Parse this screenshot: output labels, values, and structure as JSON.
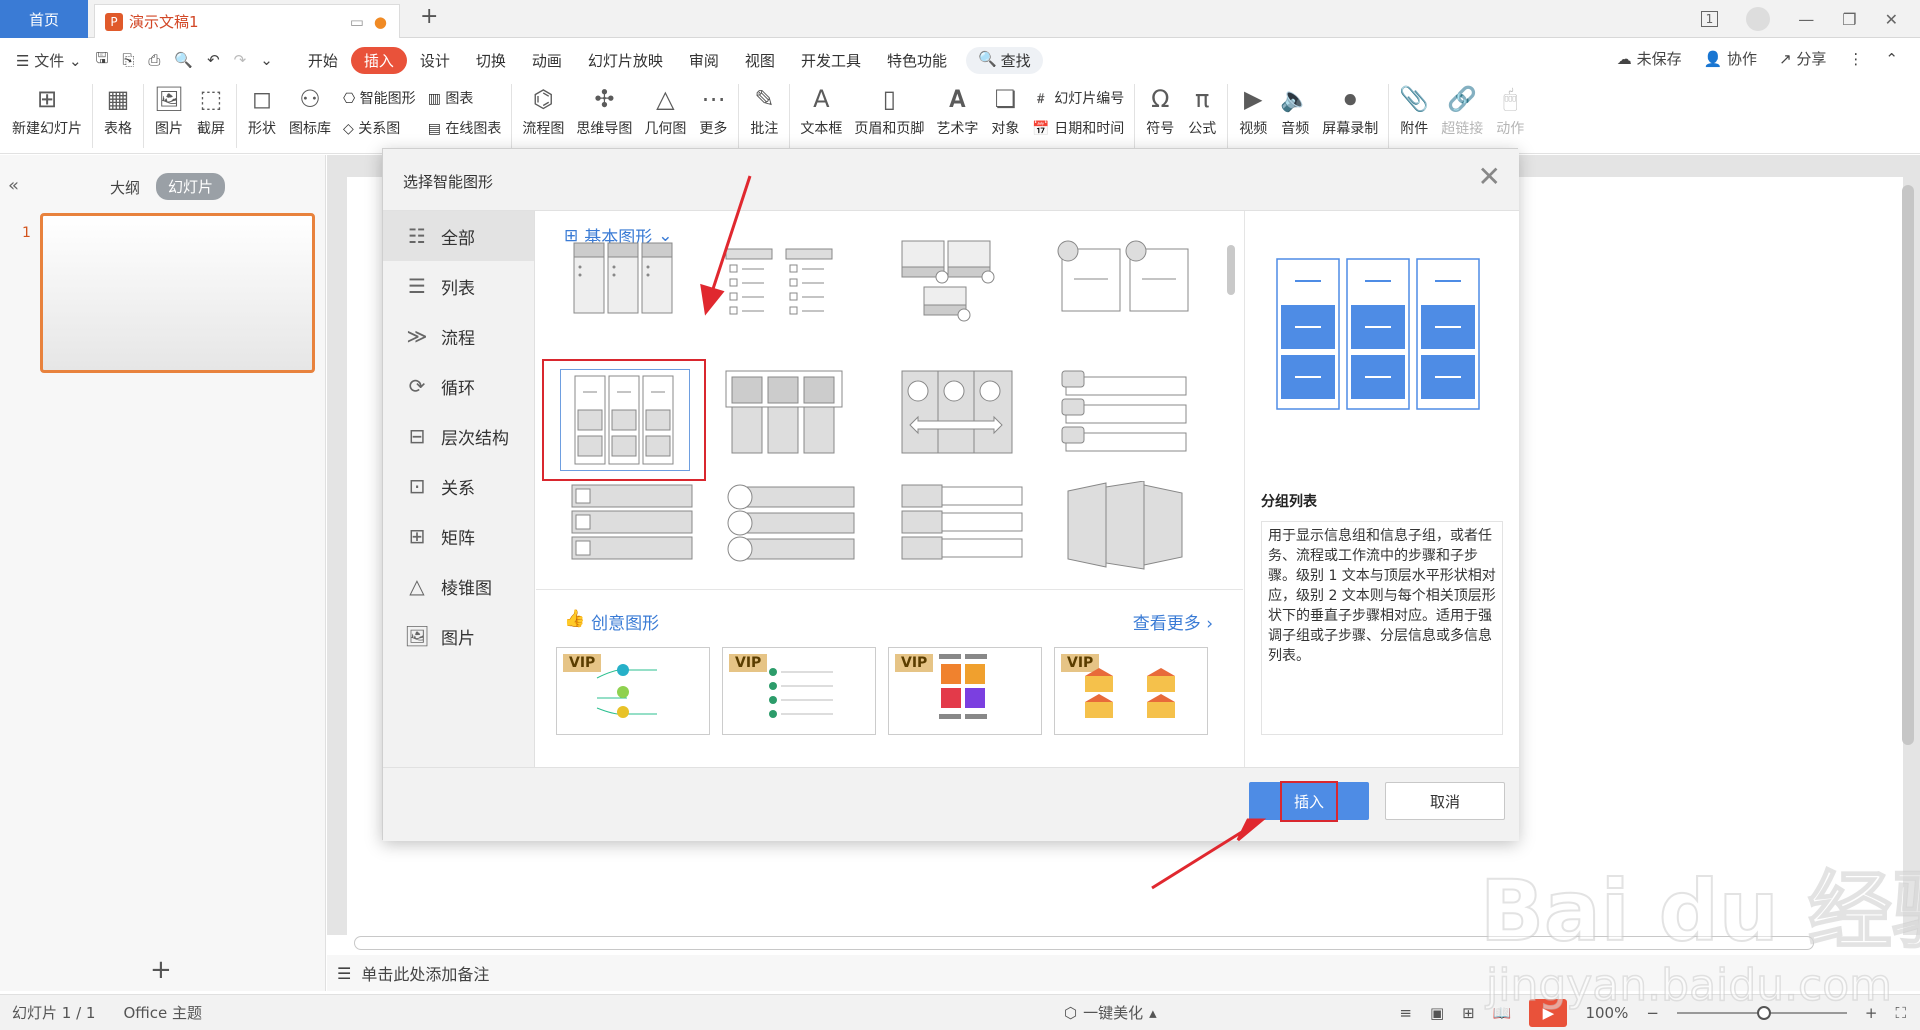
{
  "tabs": {
    "home": "首页",
    "doc": "演示文稿1"
  },
  "page_badge": "1",
  "menu": {
    "file": "文件",
    "items": [
      "开始",
      "插入",
      "设计",
      "切换",
      "动画",
      "幻灯片放映",
      "审阅",
      "视图",
      "开发工具",
      "特色功能"
    ],
    "active": "插入",
    "search": "查找",
    "right": {
      "unsaved": "未保存",
      "collab": "协作",
      "share": "分享"
    }
  },
  "ribbon": {
    "new_slide": "新建幻灯片",
    "table": "表格",
    "image": "图片",
    "screenshot": "截屏",
    "shape": "形状",
    "icons": "图标库",
    "smart_shape": "智能图形",
    "chart": "图表",
    "relation": "关系图",
    "online_chart": "在线图表",
    "flowchart": "流程图",
    "mindmap": "思维导图",
    "geometry": "几何图",
    "more": "更多",
    "comment": "批注",
    "textbox": "文本框",
    "header_footer": "页眉和页脚",
    "wordart": "艺术字",
    "object": "对象",
    "slide_number": "幻灯片编号",
    "datetime": "日期和时间",
    "symbol": "符号",
    "formula": "公式",
    "video": "视频",
    "audio": "音频",
    "screen_record": "屏幕录制",
    "attachment": "附件",
    "hyperlink": "超链接",
    "action": "动作"
  },
  "left_panel": {
    "outline": "大纲",
    "slides": "幻灯片",
    "slide_number": "1",
    "add": "+"
  },
  "notes_placeholder": "单击此处添加备注",
  "dialog": {
    "title": "选择智能图形",
    "categories": [
      {
        "label": "全部",
        "icon": "all-icon"
      },
      {
        "label": "列表",
        "icon": "list-icon"
      },
      {
        "label": "流程",
        "icon": "process-icon"
      },
      {
        "label": "循环",
        "icon": "cycle-icon"
      },
      {
        "label": "层次结构",
        "icon": "hierarchy-icon"
      },
      {
        "label": "关系",
        "icon": "relation-icon"
      },
      {
        "label": "矩阵",
        "icon": "matrix-icon"
      },
      {
        "label": "棱锥图",
        "icon": "pyramid-icon"
      },
      {
        "label": "图片",
        "icon": "picture-icon"
      }
    ],
    "basic_section": "基本图形",
    "creative_section": "创意图形",
    "see_more": "查看更多",
    "vip": "VIP",
    "preview_name": "分组列表",
    "preview_desc": "用于显示信息组和信息子组，或者任务、流程或工作流中的步骤和子步骤。级别 1 文本与顶层水平形状相对应，级别 2 文本则与每个相关顶层形状下的垂直子步骤相对应。适用于强调子组或子步骤、分层信息或多信息列表。",
    "insert": "插入",
    "cancel": "取消"
  },
  "status": {
    "slide_count": "幻灯片 1 / 1",
    "theme": "Office 主题",
    "beautify": "一键美化",
    "zoom": "100%"
  },
  "colors": {
    "accent": "#3a7bd5",
    "insert_tab": "#e9523a",
    "highlight": "#d9272e",
    "preview_blue": "#4e8ce5"
  }
}
